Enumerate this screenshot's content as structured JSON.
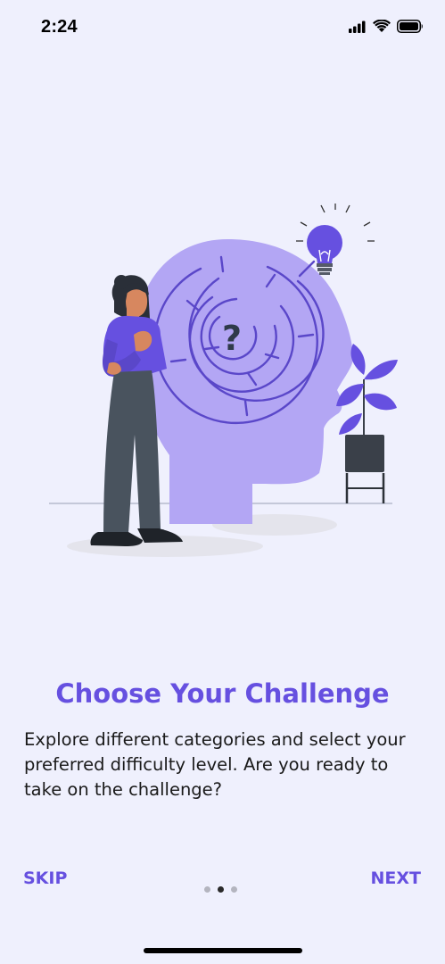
{
  "status_bar": {
    "time": "2:24",
    "icons": [
      "signal-icon",
      "wifi-icon",
      "battery-icon"
    ]
  },
  "onboarding": {
    "illustration": "person-thinking-maze-head-illustration",
    "title": "Choose Your Challenge",
    "description": "Explore different categories and select your preferred difficulty level. Are you ready to take on the challenge?",
    "page_count": 3,
    "active_page": 2
  },
  "navigation": {
    "skip_label": "SKIP",
    "next_label": "NEXT"
  },
  "colors": {
    "accent": "#6650e0",
    "background": "#eff0fd",
    "head": "#b3a6f4",
    "maze": "#5a47c9"
  }
}
